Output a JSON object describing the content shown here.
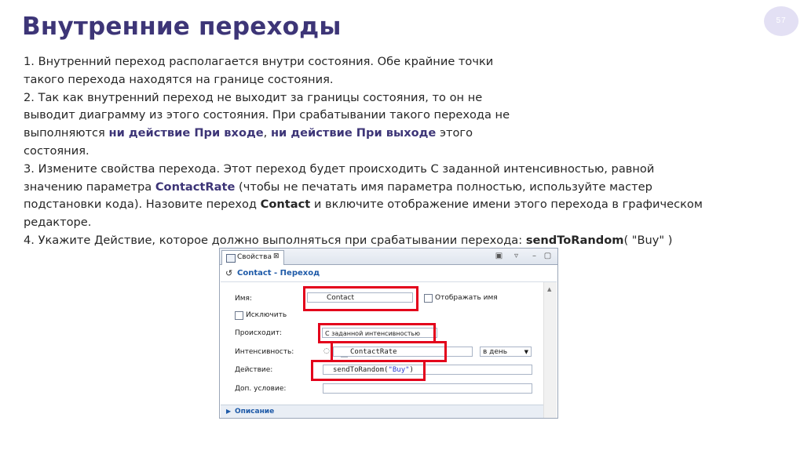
{
  "slide": {
    "title": "Внутренние переходы",
    "page_number": "57"
  },
  "body": {
    "p1": "1. Внутренний переход располагается внутри состояния. Обе крайние точки такого перехода находятся на границе состояния.",
    "p2_a": "2. Так как внутренний переход не выходит за границы состояния, то он не выводит диаграмму из этого состояния. При срабатывании такого перехода не выполняются ",
    "p2_em1": "ни действие При входе",
    "p2_b": ", ",
    "p2_em2": "ни действие При выходе",
    "p2_c": " этого состояния.",
    "p3_a": "3. Измените свойства перехода. Этот переход будет происходить С заданной интенсивностью, равной значению параметра ",
    "p3_em": "ContactRate",
    "p3_b": " (чтобы не печатать имя параметра полностью, используйте мастер подстановки кода). Назовите переход ",
    "p3_bold": "Contact",
    "p3_c": " и включите отображение имени этого перехода в графическом редакторе.",
    "p4_a": "4. Укажите Действие, которое должно выполняться при срабатывании перехода: ",
    "p4_bold": "sendToRandom",
    "p4_b": "( \"Buy\" )"
  },
  "panel": {
    "tab_label": "Свойства",
    "tab_close": "⊠",
    "header_title": "Contact - Переход",
    "name_label": "Имя:",
    "name_value": "Contact",
    "show_name_label": "Отображать имя",
    "exclude_label": "Исключить",
    "occurs_label": "Происходит:",
    "occurs_value": "С заданной интенсивностью",
    "rate_label": "Интенсивность:",
    "rate_value": "ContactRate",
    "rate_unit": "в день",
    "action_label": "Действие:",
    "action_code_a": "sendToRandom(",
    "action_code_str": "\"Buy\"",
    "action_code_b": ")",
    "condition_label": "Доп. условие:",
    "condition_value": "",
    "description_section": "Описание"
  },
  "colors": {
    "title": "#3d3577",
    "emphasis": "#3d3577",
    "highlight_box": "#e3001b",
    "panel_header": "#1e5aa8",
    "badge": "#e3e0f4"
  }
}
